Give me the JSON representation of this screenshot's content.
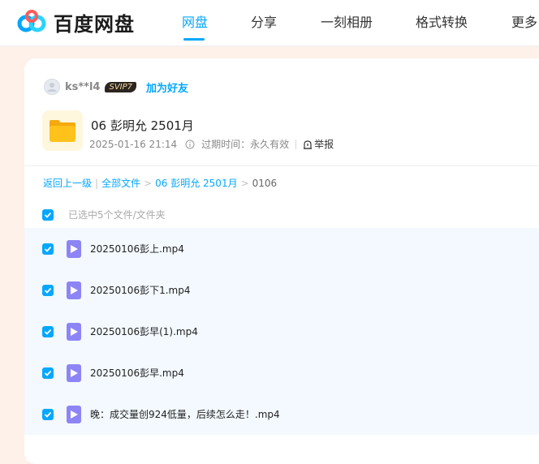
{
  "brand": {
    "name": "百度网盘"
  },
  "nav": {
    "items": [
      {
        "label": "网盘",
        "active": true
      },
      {
        "label": "分享",
        "active": false
      },
      {
        "label": "一刻相册",
        "active": false
      },
      {
        "label": "格式转换",
        "active": false
      },
      {
        "label": "更多",
        "active": false
      }
    ]
  },
  "share": {
    "user": "ks**l4",
    "vip_badge": "SVIP7",
    "add_friend": "加为好友",
    "title": "06 彭明允 2501月",
    "date": "2025-01-16 21:14",
    "expire": "过期时间：永久有效",
    "report": "举报"
  },
  "breadcrumb": {
    "back": "返回上一级",
    "separator": "|",
    "items": [
      "全部文件",
      "06 彭明允 2501月",
      "0106"
    ]
  },
  "selection": {
    "text": "已选中5个文件/文件夹"
  },
  "files": [
    {
      "name": "20250106彭上.mp4"
    },
    {
      "name": "20250106彭下1.mp4"
    },
    {
      "name": "20250106彭早(1).mp4"
    },
    {
      "name": "20250106彭早.mp4"
    },
    {
      "name": "晚：成交量创924低量，后续怎么走！.mp4"
    }
  ],
  "colors": {
    "accent": "#06a7ff",
    "page_bg": "#fdf1ea",
    "row_bg": "#f3f9fe",
    "video_icon": "#8d85f5",
    "folder": "#ffc21a"
  }
}
